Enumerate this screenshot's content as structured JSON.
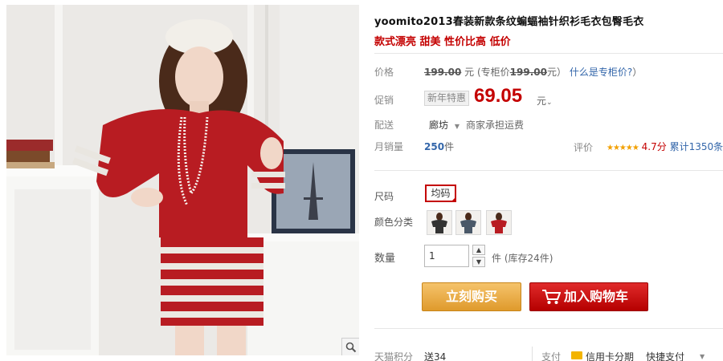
{
  "product": {
    "title": "yoomito2013春装新款条纹蝙蝠袖针织衫毛衣包臀毛衣",
    "subtitle": "款式漂亮 甜美 性价比高 低价"
  },
  "price": {
    "label": "价格",
    "original": "199.00",
    "unit": "元",
    "counter_prefix": "(专柜价",
    "counter_price": "199.00",
    "counter_suffix": "元）",
    "help_link": "什么是专柜价?",
    "help_close": "）"
  },
  "promo": {
    "label": "促销",
    "tag": "新年特惠",
    "price": "69.05",
    "unit": "元"
  },
  "shipping": {
    "label": "配送",
    "from": "廊坊",
    "note": "商家承担运费"
  },
  "sales": {
    "label": "月销量",
    "count": "250",
    "unit": "件",
    "rating_label": "评价",
    "stars": "★★★★★",
    "score": "4.7分",
    "review_link": "累计1350条"
  },
  "size": {
    "label": "尺码",
    "selected": "均码"
  },
  "color": {
    "label": "颜色分类",
    "options": [
      "black",
      "grey",
      "red"
    ]
  },
  "quantity": {
    "label": "数量",
    "value": "1",
    "unit": "件",
    "stock": "(库存24件)"
  },
  "actions": {
    "buy": "立刻购买",
    "cart": "加入购物车"
  },
  "footer": {
    "points_label": "天猫积分",
    "points_value": "送34",
    "pay_label": "支付",
    "card_pay": "信用卡分期",
    "quick_pay": "快捷支付"
  },
  "colors": {
    "accent_red": "#c40000",
    "buy_orange": "#df9a2c",
    "star_gold": "#f2a000"
  }
}
